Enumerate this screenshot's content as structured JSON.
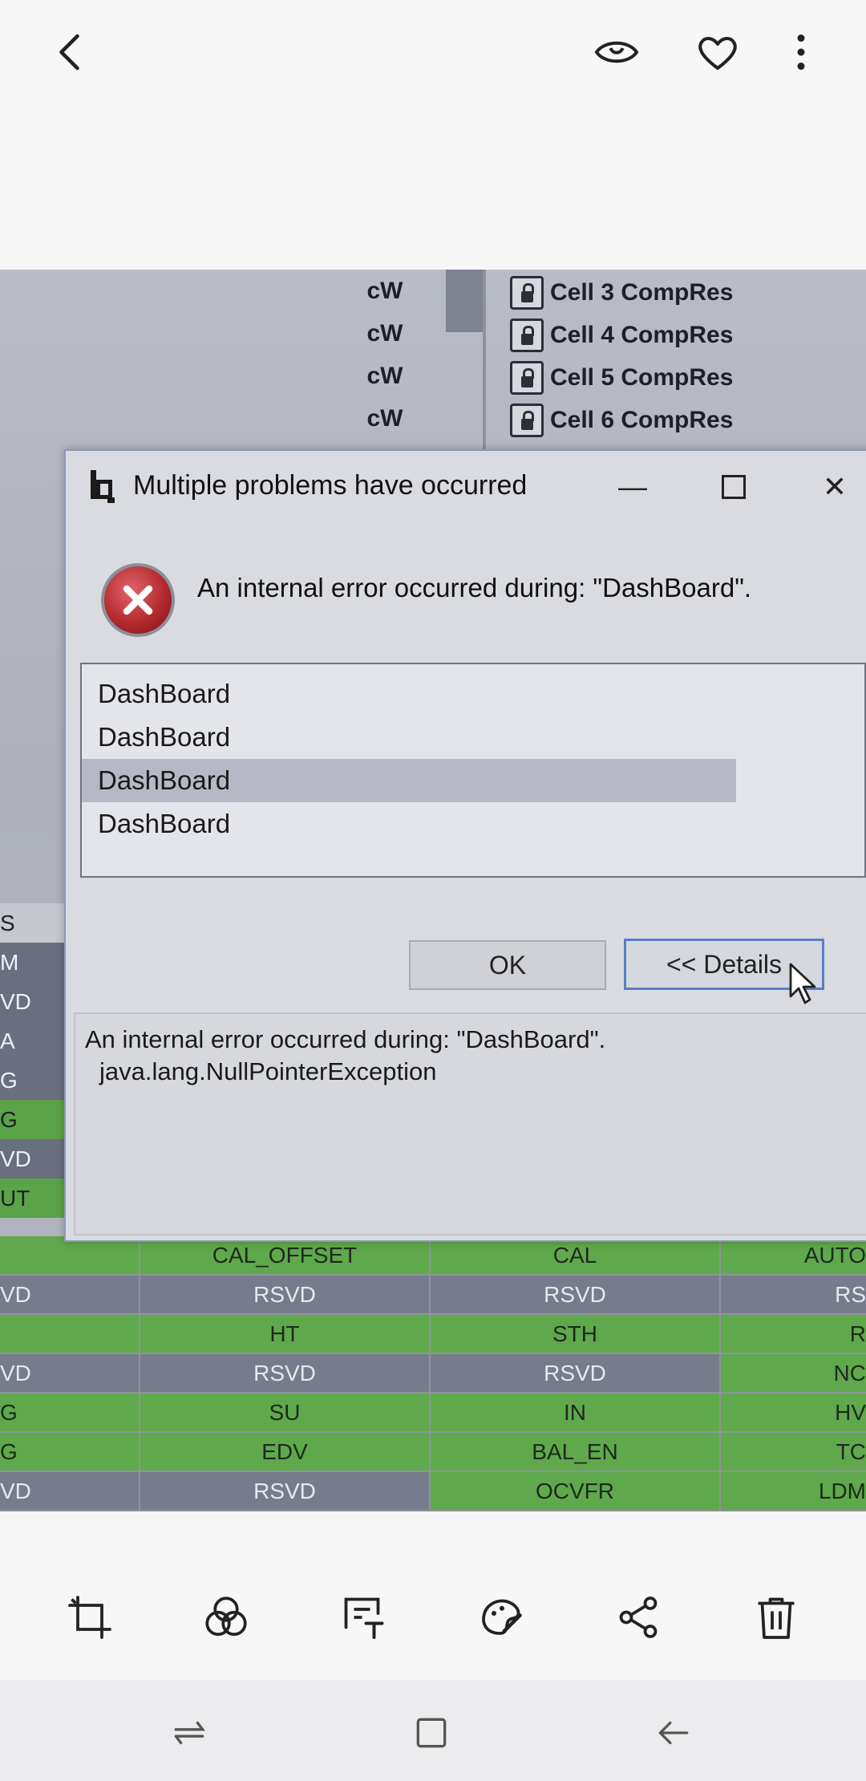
{
  "topbar": {
    "back_icon": "chevron-left-icon",
    "actions": [
      "eye-icon",
      "heart-icon",
      "more-vertical-icon"
    ]
  },
  "background": {
    "units": [
      "cW",
      "cW",
      "cW",
      "cW"
    ],
    "cells": [
      "Cell 3 CompRes",
      "Cell 4 CompRes",
      "Cell 5 CompRes",
      "Cell 6 CompRes"
    ],
    "left_labels": [
      "S",
      "M",
      "VD",
      "A",
      "G",
      "G",
      "VD",
      "UT"
    ],
    "table": [
      [
        "",
        "CAL_OFFSET",
        "CAL",
        "AUTO"
      ],
      [
        "VD",
        "RSVD",
        "RSVD",
        "RS"
      ],
      [
        "",
        "HT",
        "STH",
        "R"
      ],
      [
        "VD",
        "RSVD",
        "RSVD",
        "NC"
      ],
      [
        "G",
        "SU",
        "IN",
        "HV"
      ],
      [
        "G",
        "EDV",
        "BAL_EN",
        "TC"
      ],
      [
        "VD",
        "RSVD",
        "OCVFR",
        "LDM"
      ]
    ]
  },
  "dialog": {
    "title": "Multiple problems have occurred",
    "minimize_label": "—",
    "close_label": "✕",
    "message": "An internal error occurred during: \"DashBoard\".",
    "list": [
      "DashBoard",
      "DashBoard",
      "DashBoard",
      "DashBoard"
    ],
    "ok_label": "OK",
    "details_label": "<< Details",
    "detail_line1": "An internal error occurred during: \"DashBoard\".",
    "detail_line2": "java.lang.NullPointerException"
  },
  "colors": {
    "accent_blue": "#5a7ec4",
    "error_red": "#b32a2e",
    "table_green": "#5fa84c",
    "table_gray": "#777c8c"
  }
}
